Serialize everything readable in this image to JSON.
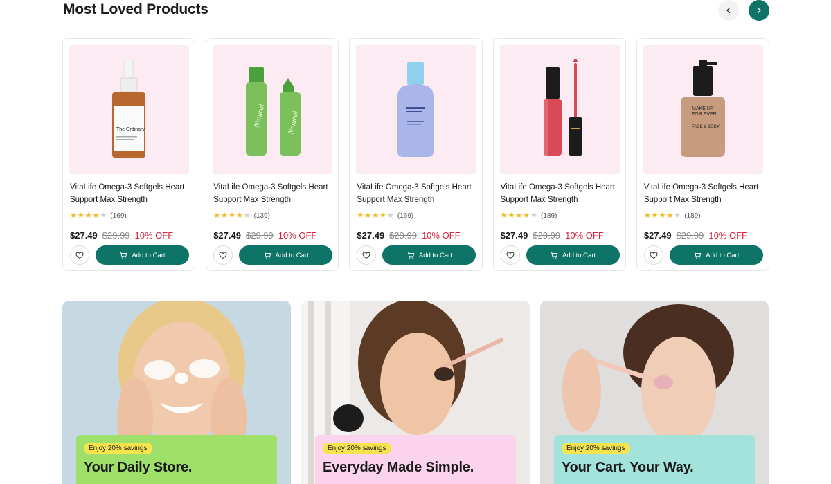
{
  "section": {
    "title": "Most Loved Products",
    "prev_icon": "chevron-left-icon",
    "next_icon": "chevron-right-icon"
  },
  "colors": {
    "brand": "#0f7468",
    "discount": "#d8243e",
    "card_image_bg": "#fdebf3",
    "star": "#f5b819",
    "badge": "#f7e34c"
  },
  "products": [
    {
      "image": "dropper-serum-bottle",
      "name": "VitaLife Omega-3 Softgels Heart Support Max Strength",
      "rating": 4,
      "reviews": "(169)",
      "price": "$27.49",
      "old_price": "$29.99",
      "discount": "10% OFF",
      "cart_label": "Add to Cart"
    },
    {
      "image": "green-lipstick-pair",
      "name": "VitaLife Omega-3 Softgels Heart Support Max Strength",
      "rating": 4,
      "reviews": "(139)",
      "price": "$27.49",
      "old_price": "$29.99",
      "discount": "10% OFF",
      "cart_label": "Add to Cart"
    },
    {
      "image": "blue-lotion-bottle",
      "name": "VitaLife Omega-3 Softgels Heart Support Max Strength",
      "rating": 4,
      "reviews": "(169)",
      "price": "$27.49",
      "old_price": "$29.99",
      "discount": "10% OFF",
      "cart_label": "Add to Cart"
    },
    {
      "image": "lip-gloss-tube",
      "name": "VitaLife Omega-3 Softgels Heart Support Max Strength",
      "rating": 4,
      "reviews": "(189)",
      "price": "$27.49",
      "old_price": "$29.99",
      "discount": "10% OFF",
      "cart_label": "Add to Cart"
    },
    {
      "image": "foundation-pump-bottle",
      "name": "VitaLife Omega-3 Softgels Heart Support Max Strength",
      "rating": 4,
      "reviews": "(189)",
      "price": "$27.49",
      "old_price": "$29.99",
      "discount": "10% OFF",
      "cart_label": "Add to Cart"
    }
  ],
  "product_bottle_labels": {
    "ordinary_brand": "The Ordinary.",
    "natural_brand": "Natural",
    "foundation_line1": "MAKE UP",
    "foundation_line2": "FOR EVER",
    "foundation_line3": "FACE & BODY"
  },
  "banners": [
    {
      "badge": "Enjoy 20% savings",
      "title": "Your Daily Store.",
      "panel_color": "#9ee06a",
      "photo": "woman-face-wash"
    },
    {
      "badge": "Enjoy 20% savings",
      "title": "Everyday Made Simple.",
      "panel_color": "#fbd3ec",
      "photo": "woman-makeup-brush"
    },
    {
      "badge": "Enjoy 20% savings",
      "title": "Your Cart. Your Way.",
      "panel_color": "#a4e3dc",
      "photo": "woman-blush-brush"
    }
  ]
}
